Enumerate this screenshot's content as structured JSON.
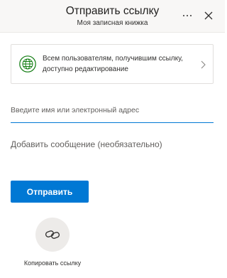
{
  "header": {
    "title": "Отправить ссылку",
    "subtitle": "Моя записная книжка"
  },
  "link_settings": {
    "text": "Всем пользователям, получившим ссылку, доступно редактирование",
    "icon": "globe-icon"
  },
  "recipient": {
    "placeholder": "Введите имя или электронный адрес",
    "value": ""
  },
  "message": {
    "placeholder": "Добавить сообщение (необязательно)",
    "value": ""
  },
  "send_button": {
    "label": "Отправить"
  },
  "copy_link": {
    "label": "Копировать ссылку",
    "icon": "link-icon"
  },
  "colors": {
    "accent": "#0078d4",
    "header_bg": "#f8f7f6",
    "globe": "#107c10",
    "copy_circle_bg": "#edebe9"
  }
}
